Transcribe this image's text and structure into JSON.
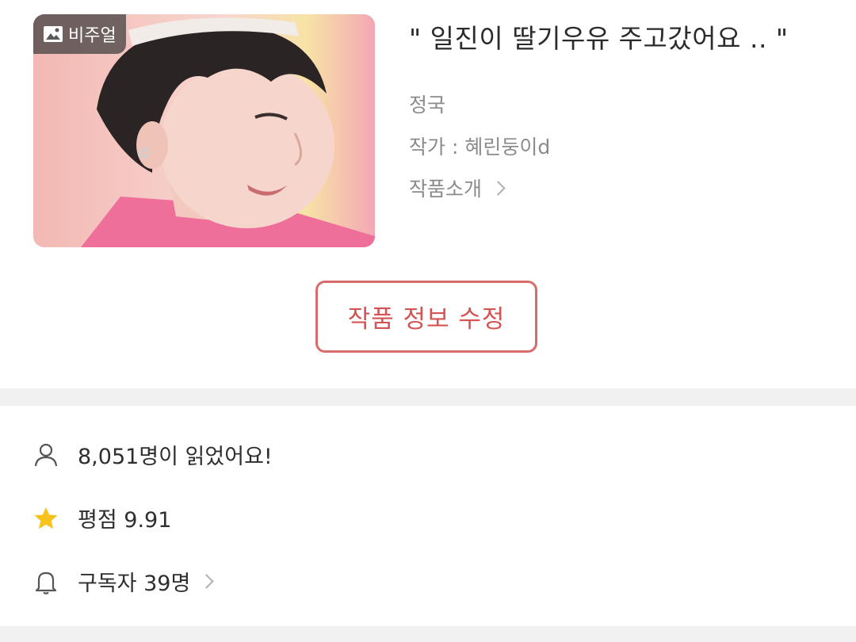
{
  "cover": {
    "badge_label": "비주얼",
    "badge_icon": "image-icon"
  },
  "work": {
    "title": "\"  일진이 딸기우유 주고갔어요  ..  \"",
    "genre": "정국",
    "author": "작가 : 혜린둥이d",
    "intro_label": "작품소개"
  },
  "actions": {
    "edit_label": "작품 정보 수정"
  },
  "stats": {
    "readers": "8,051명이 읽었어요!",
    "rating": "평점 9.91",
    "subscribers": "구독자 39명"
  },
  "colors": {
    "accent": "#d96b6b",
    "star": "#f6c21b",
    "divider": "#f1f1f2"
  }
}
